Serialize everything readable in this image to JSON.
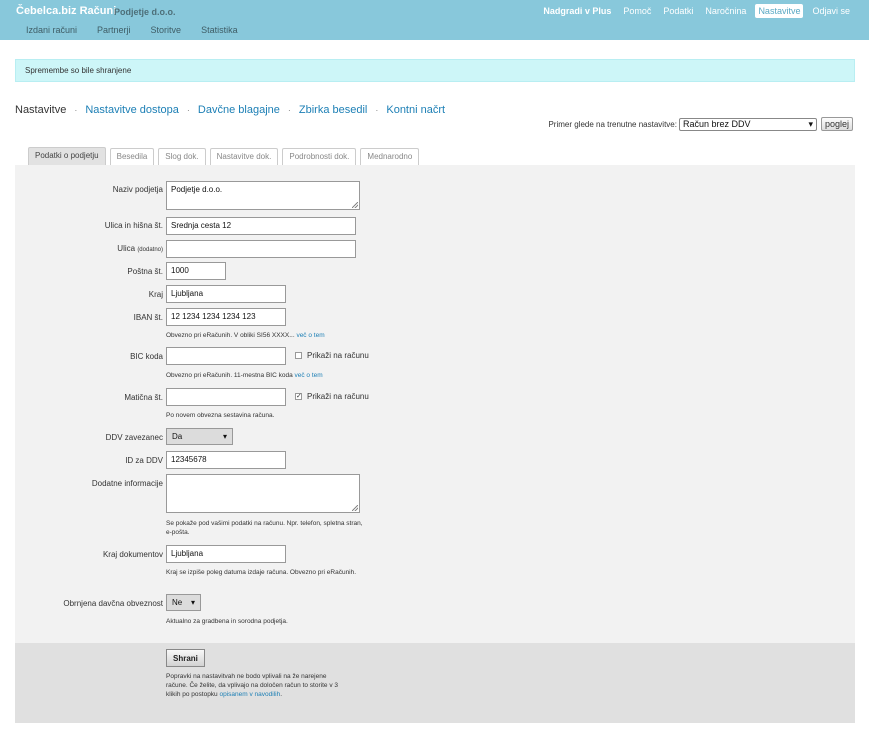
{
  "header": {
    "brand": "Čebelca.biz Računi",
    "company": "Podjetje d.o.o.",
    "nav": [
      {
        "label": "Nadgradi v Plus",
        "bold": true,
        "active": false
      },
      {
        "label": "Pomoč",
        "bold": false,
        "active": false
      },
      {
        "label": "Podatki",
        "bold": false,
        "active": false
      },
      {
        "label": "Naročnina",
        "bold": false,
        "active": false
      },
      {
        "label": "Nastavitve",
        "bold": false,
        "active": true
      },
      {
        "label": "Odjavi se",
        "bold": false,
        "active": false
      }
    ],
    "subnav": [
      "Izdani računi",
      "Partnerji",
      "Storitve",
      "Statistika"
    ]
  },
  "notice": "Spremembe so bile shranjene",
  "breadcrumbs": {
    "current": "Nastavitve",
    "links": [
      "Nastavitve dostopa",
      "Davčne blagajne",
      "Zbirka besedil",
      "Kontni načrt"
    ],
    "separator": "·"
  },
  "preview": {
    "label": "Primer glede na trenutne nastavitve:",
    "selected": "Račun brez DDV",
    "button": "poglej"
  },
  "tabs": [
    "Podatki o podjetju",
    "Besedila",
    "Slog dok.",
    "Nastavitve dok.",
    "Podrobnosti dok.",
    "Mednarodno"
  ],
  "form": {
    "naziv": {
      "label": "Naziv podjetja",
      "value": "Podjetje d.o.o."
    },
    "ulica": {
      "label": "Ulica in hišna št.",
      "value": "Srednja cesta 12"
    },
    "ulica2": {
      "label": "Ulica",
      "label_small": "(dodatno)",
      "value": ""
    },
    "posta": {
      "label": "Poštna št.",
      "value": "1000"
    },
    "kraj": {
      "label": "Kraj",
      "value": "Ljubljana"
    },
    "iban": {
      "label": "IBAN št.",
      "value": "12 1234 1234 1234 123",
      "hint": "Obvezno pri eRačunih. V obliki SI56 XXXX...",
      "hint_link": "več o tem"
    },
    "bic": {
      "label": "BIC koda",
      "value": "",
      "checkbox_label": "Prikaži na računu",
      "checked": false,
      "hint": "Obvezno pri eRačunih. 11-mestna BIC koda",
      "hint_link": "več o tem"
    },
    "maticna": {
      "label": "Matična št.",
      "value": "",
      "checkbox_label": "Prikaži na računu",
      "checked": true,
      "hint": "Po novem obvezna sestavina računa."
    },
    "ddv": {
      "label": "DDV zavezanec",
      "value": "Da"
    },
    "idddv": {
      "label": "ID za DDV",
      "value": "12345678"
    },
    "dodatne": {
      "label": "Dodatne informacije",
      "value": "",
      "hint": "Se pokaže pod vašimi podatki na računu. Npr. telefon, spletna stran, e-pošta."
    },
    "krajdok": {
      "label": "Kraj dokumentov",
      "value": "Ljubljana",
      "hint": "Kraj se izpiše poleg datuma izdaje računa. Obvezno pri eRačunih."
    },
    "obrnjena": {
      "label": "Obrnjena davčna obveznost",
      "value": "Ne",
      "hint": "Aktualno za gradbena in sorodna podjetja."
    }
  },
  "footer": {
    "save": "Shrani",
    "note": "Popravki na nastavitvah ne bodo vplivali na že narejene račune. Če želite, da vplivajo na določen račun to storite v 3 klikih po postopku",
    "note_link": "opisanem v navodilih",
    "note_end": "."
  }
}
